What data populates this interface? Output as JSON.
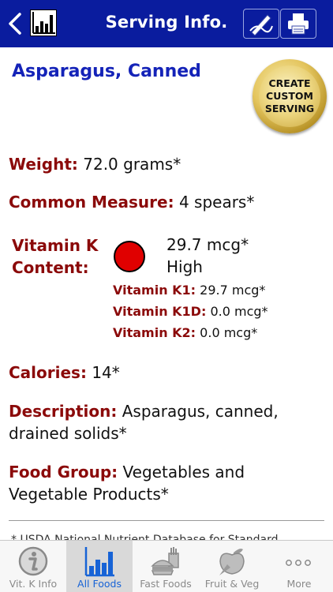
{
  "nav": {
    "title": "Serving Info."
  },
  "food": {
    "name": "Asparagus, Canned"
  },
  "create_button": {
    "label": "CREATE\nCUSTOM\nSERVING"
  },
  "details": {
    "weight_label": "Weight:",
    "weight_value": "72.0 grams*",
    "measure_label": "Common Measure:",
    "measure_value": "4 spears*",
    "vitk_label": "Vitamin K\nContent:",
    "vitk_value": "29.7 mcg*",
    "vitk_level": "High",
    "vitk_level_color": "#e00000",
    "k1_label": "Vitamin K1:",
    "k1_value": "29.7 mcg*",
    "k1d_label": "Vitamin K1D:",
    "k1d_value": "0.0 mcg*",
    "k2_label": "Vitamin K2:",
    "k2_value": "0.0 mcg*",
    "calories_label": "Calories:",
    "calories_value": "14*",
    "description_label": "Description:",
    "description_value": "Asparagus, canned, drained solids*",
    "group_label": "Food Group:",
    "group_value": "Vegetables and Vegetable Products*"
  },
  "footnote": "* USDA National Nutrient Database for Standard",
  "tabs": [
    {
      "label": "Vit. K Info",
      "icon": "info-icon"
    },
    {
      "label": "All Foods",
      "icon": "bar-chart-icon"
    },
    {
      "label": "Fast Foods",
      "icon": "fast-food-icon"
    },
    {
      "label": "Fruit & Veg",
      "icon": "fruit-veg-icon"
    },
    {
      "label": "More",
      "icon": "more-icon"
    }
  ],
  "colors": {
    "nav_bg": "#0a1c9e",
    "title_blue": "#1423b8",
    "label_red": "#8b0a0a",
    "active_tab": "#1763d6"
  }
}
